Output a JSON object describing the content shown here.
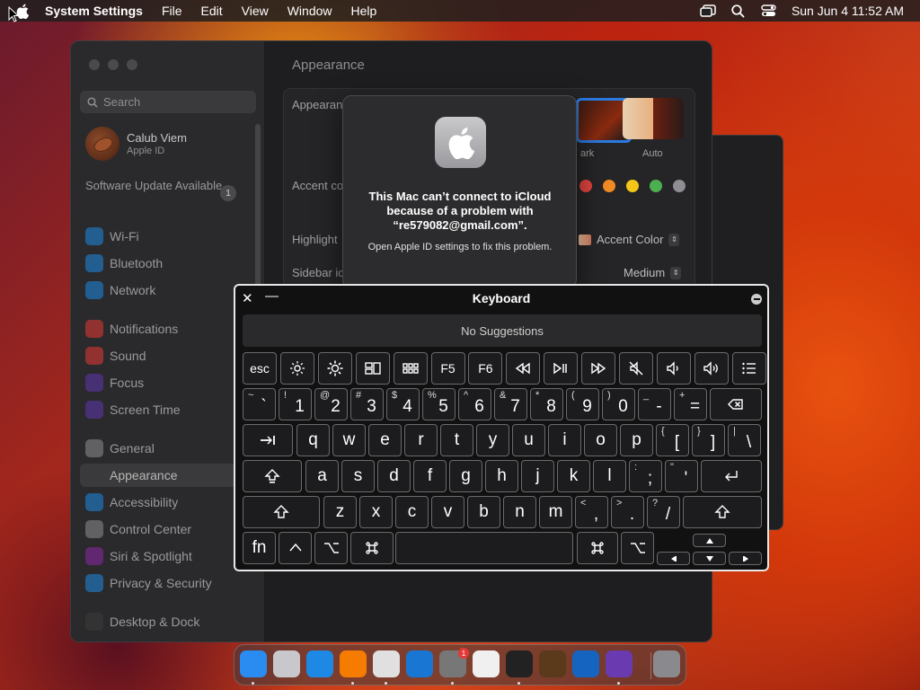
{
  "menubar": {
    "app_name": "System Settings",
    "menus": [
      "File",
      "Edit",
      "View",
      "Window",
      "Help"
    ],
    "clock": "Sun Jun 4  11:52 AM"
  },
  "sidebar": {
    "search_placeholder": "Search",
    "profile_name": "Calub Viem",
    "profile_sub": "Apple ID",
    "software_update": "Software Update Available",
    "update_badge": "1",
    "items": [
      {
        "label": "Wi-Fi",
        "color": "#1e88e5"
      },
      {
        "label": "Bluetooth",
        "color": "#1e88e5"
      },
      {
        "label": "Network",
        "color": "#1e88e5"
      },
      {
        "label": "Notifications",
        "color": "#e53935"
      },
      {
        "label": "Sound",
        "color": "#e53935"
      },
      {
        "label": "Focus",
        "color": "#5e35b1"
      },
      {
        "label": "Screen Time",
        "color": "#5e35b1"
      },
      {
        "label": "General",
        "color": "#8e8e93"
      },
      {
        "label": "Appearance",
        "color": "#3a3a3c"
      },
      {
        "label": "Accessibility",
        "color": "#1e88e5"
      },
      {
        "label": "Control Center",
        "color": "#8e8e93"
      },
      {
        "label": "Siri & Spotlight",
        "color": "#8e24aa"
      },
      {
        "label": "Privacy & Security",
        "color": "#1e88e5"
      },
      {
        "label": "Desktop & Dock",
        "color": "#3a3a3c"
      }
    ]
  },
  "content": {
    "title": "Appearance",
    "appearance_label": "Appearanc",
    "dark_label": "ark",
    "auto_label": "Auto",
    "accent_label": "Accent co",
    "highlight_label": "Highlight",
    "highlight_value": "Accent Color",
    "sidebar_label": "Sidebar ic",
    "sidebar_value": "Medium",
    "accent_colors": [
      "#e0443e",
      "#f08a24",
      "#f5c518",
      "#4caf50",
      "#8e8e93"
    ]
  },
  "alert": {
    "title": "This Mac can’t connect to iCloud because of a problem with “re579082@gmail.com”.",
    "message": "Open Apple ID settings to fix this problem."
  },
  "keyboard": {
    "title": "Keyboard",
    "suggestions": "No Suggestions",
    "fn_row": [
      "esc",
      "",
      "",
      "",
      "",
      "F5",
      "F6",
      "",
      "",
      "",
      "",
      "",
      "",
      ""
    ],
    "number_row": [
      {
        "up": "~",
        "lo": "`"
      },
      {
        "up": "!",
        "lo": "1"
      },
      {
        "up": "@",
        "lo": "2"
      },
      {
        "up": "#",
        "lo": "3"
      },
      {
        "up": "$",
        "lo": "4"
      },
      {
        "up": "%",
        "lo": "5"
      },
      {
        "up": "^",
        "lo": "6"
      },
      {
        "up": "&",
        "lo": "7"
      },
      {
        "up": "*",
        "lo": "8"
      },
      {
        "up": "(",
        "lo": "9"
      },
      {
        "up": ")",
        "lo": "0"
      },
      {
        "up": "_",
        "lo": "-"
      },
      {
        "up": "+",
        "lo": "="
      }
    ],
    "row_q": [
      "q",
      "w",
      "e",
      "r",
      "t",
      "y",
      "u",
      "i",
      "o",
      "p"
    ],
    "row_q_extra": [
      {
        "up": "{",
        "lo": "["
      },
      {
        "up": "}",
        "lo": "]"
      },
      {
        "up": "|",
        "lo": "\\"
      }
    ],
    "row_a": [
      "a",
      "s",
      "d",
      "f",
      "g",
      "h",
      "j",
      "k",
      "l"
    ],
    "row_a_extra": [
      {
        "up": ":",
        "lo": ";"
      },
      {
        "up": "\"",
        "lo": "'"
      }
    ],
    "row_z": [
      "z",
      "x",
      "c",
      "v",
      "b",
      "n",
      "m"
    ],
    "row_z_extra": [
      {
        "up": "<",
        "lo": ","
      },
      {
        "up": ">",
        "lo": "."
      },
      {
        "up": "?",
        "lo": "/"
      }
    ],
    "fn_label": "fn"
  },
  "dock": {
    "apps": [
      {
        "name": "Finder",
        "color": "#2a8cf0",
        "glyph": ""
      },
      {
        "name": "Launchpad",
        "color": "#c8c8cc",
        "glyph": ""
      },
      {
        "name": "Safari",
        "color": "#1e88e5",
        "glyph": ""
      },
      {
        "name": "Firefox",
        "color": "#f57c00",
        "glyph": ""
      },
      {
        "name": "Chrome",
        "color": "#e0e0e0",
        "glyph": ""
      },
      {
        "name": "App Store",
        "color": "#1976d2",
        "glyph": ""
      },
      {
        "name": "System Settings",
        "color": "#777",
        "glyph": ""
      },
      {
        "name": "TextEdit",
        "color": "#f0f0f0",
        "glyph": ""
      },
      {
        "name": "Terminal",
        "color": "#222",
        "glyph": ""
      },
      {
        "name": "GarageBand",
        "color": "#5a3a1a",
        "glyph": ""
      },
      {
        "name": "VS Code",
        "color": "#1565c0",
        "glyph": ""
      },
      {
        "name": "Visual Studio",
        "color": "#6a3ab0",
        "glyph": ""
      },
      {
        "name": "Trash",
        "color": "#8a8a8e",
        "glyph": ""
      }
    ],
    "settings_badge": "1"
  }
}
